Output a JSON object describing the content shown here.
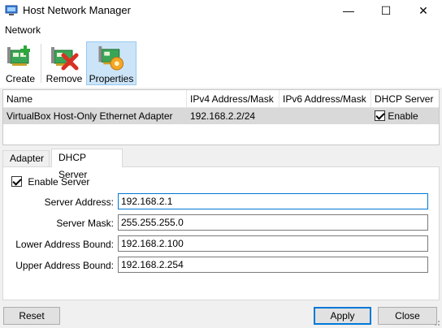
{
  "window": {
    "title": "Host Network Manager",
    "controls": {
      "minimize": "—",
      "maximize": "☐",
      "close": "✕"
    }
  },
  "menu": {
    "items": [
      "Network"
    ]
  },
  "toolbar": {
    "create_label": "Create",
    "remove_label": "Remove",
    "properties_label": "Properties"
  },
  "adapters_table": {
    "columns": [
      "Name",
      "IPv4 Address/Mask",
      "IPv6 Address/Mask",
      "DHCP Server"
    ],
    "rows": [
      {
        "name": "VirtualBox Host-Only Ethernet Adapter",
        "ipv4": "192.168.2.2/24",
        "ipv6": "",
        "dhcp_checked": true,
        "dhcp_label": "Enable"
      }
    ]
  },
  "tabs": {
    "adapter_label": "Adapter",
    "dhcp_label": "DHCP Server",
    "active": "DHCP Server"
  },
  "dhcp": {
    "enable_checked": true,
    "enable_label": "Enable Server",
    "server_address_label": "Server Address:",
    "server_address_value": "192.168.2.1",
    "server_mask_label": "Server Mask:",
    "server_mask_value": "255.255.255.0",
    "lower_bound_label": "Lower Address Bound:",
    "lower_bound_value": "192.168.2.100",
    "upper_bound_label": "Upper Address Bound:",
    "upper_bound_value": "192.168.2.254"
  },
  "buttons": {
    "reset_label": "Reset",
    "apply_label": "Apply",
    "close_label": "Close"
  },
  "colors": {
    "accent": "#0078d7",
    "selected_row": "#d9d9d9",
    "toolbar_hover": "#cce4f7"
  }
}
